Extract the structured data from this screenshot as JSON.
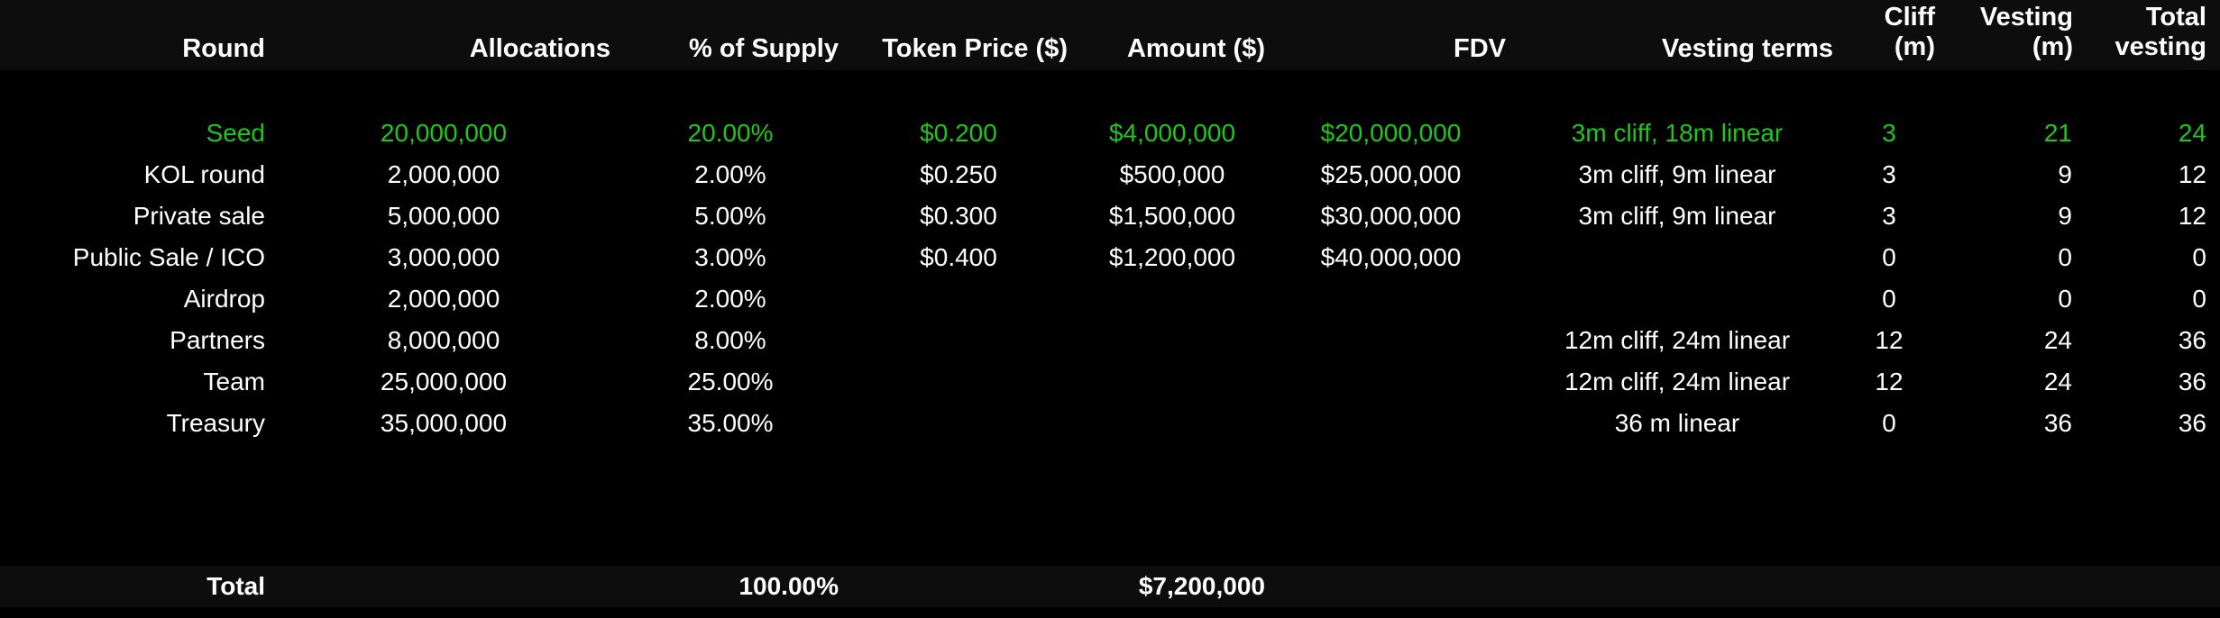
{
  "colors": {
    "background": "#000000",
    "band": "#0d0d0d",
    "text": "#ffffff",
    "highlight": "#22c51e"
  },
  "headers": {
    "round": "Round",
    "allocations": "Allocations",
    "pct_supply": "% of Supply",
    "token_price": "Token Price ($)",
    "amount": "Amount ($)",
    "fdv": "FDV",
    "vesting_terms": "Vesting terms",
    "cliff_line1": "Cliff",
    "cliff_line2": "(m)",
    "vesting_line1": "Vesting",
    "vesting_line2": "(m)",
    "total_line1": "Total",
    "total_line2": "vesting"
  },
  "rows": [
    {
      "round": "Seed",
      "allocations": "20,000,000",
      "pct": "20.00%",
      "price": "$0.200",
      "amount": "$4,000,000",
      "fdv": "$20,000,000",
      "terms": "3m cliff, 18m linear",
      "cliff": "3",
      "vesting": "21",
      "total": "24",
      "highlight": true
    },
    {
      "round": "KOL round",
      "allocations": "2,000,000",
      "pct": "2.00%",
      "price": "$0.250",
      "amount": "$500,000",
      "fdv": "$25,000,000",
      "terms": "3m cliff, 9m linear",
      "cliff": "3",
      "vesting": "9",
      "total": "12",
      "highlight": false
    },
    {
      "round": "Private sale",
      "allocations": "5,000,000",
      "pct": "5.00%",
      "price": "$0.300",
      "amount": "$1,500,000",
      "fdv": "$30,000,000",
      "terms": "3m cliff, 9m linear",
      "cliff": "3",
      "vesting": "9",
      "total": "12",
      "highlight": false
    },
    {
      "round": "Public Sale / ICO",
      "allocations": "3,000,000",
      "pct": "3.00%",
      "price": "$0.400",
      "amount": "$1,200,000",
      "fdv": "$40,000,000",
      "terms": "",
      "cliff": "0",
      "vesting": "0",
      "total": "0",
      "highlight": false
    },
    {
      "round": "Airdrop",
      "allocations": "2,000,000",
      "pct": "2.00%",
      "price": "",
      "amount": "",
      "fdv": "",
      "terms": "",
      "cliff": "0",
      "vesting": "0",
      "total": "0",
      "highlight": false
    },
    {
      "round": "Partners",
      "allocations": "8,000,000",
      "pct": "8.00%",
      "price": "",
      "amount": "",
      "fdv": "",
      "terms": "12m cliff, 24m linear",
      "cliff": "12",
      "vesting": "24",
      "total": "36",
      "highlight": false
    },
    {
      "round": "Team",
      "allocations": "25,000,000",
      "pct": "25.00%",
      "price": "",
      "amount": "",
      "fdv": "",
      "terms": "12m cliff, 24m linear",
      "cliff": "12",
      "vesting": "24",
      "total": "36",
      "highlight": false
    },
    {
      "round": "Treasury",
      "allocations": "35,000,000",
      "pct": "35.00%",
      "price": "",
      "amount": "",
      "fdv": "",
      "terms": "36 m linear",
      "cliff": "0",
      "vesting": "36",
      "total": "36",
      "highlight": false
    }
  ],
  "totals": {
    "label": "Total",
    "pct": "100.00%",
    "amount": "$7,200,000"
  }
}
